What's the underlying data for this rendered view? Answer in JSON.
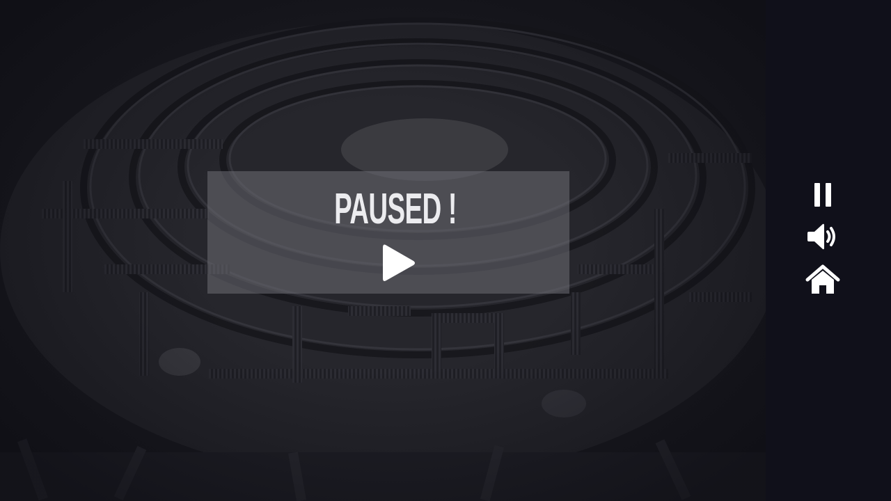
{
  "pause_menu": {
    "title": "PAUSED !",
    "resume_icon": "play-icon"
  },
  "side_controls": [
    {
      "name": "pause-button",
      "icon": "pause-icon"
    },
    {
      "name": "sound-button",
      "icon": "speaker-icon"
    },
    {
      "name": "home-button",
      "icon": "home-icon"
    }
  ],
  "colors": {
    "panel_bg": "#10101a",
    "overlay_bg": "#6e6e74",
    "text": "#ececef",
    "icon": "#ffffff"
  }
}
